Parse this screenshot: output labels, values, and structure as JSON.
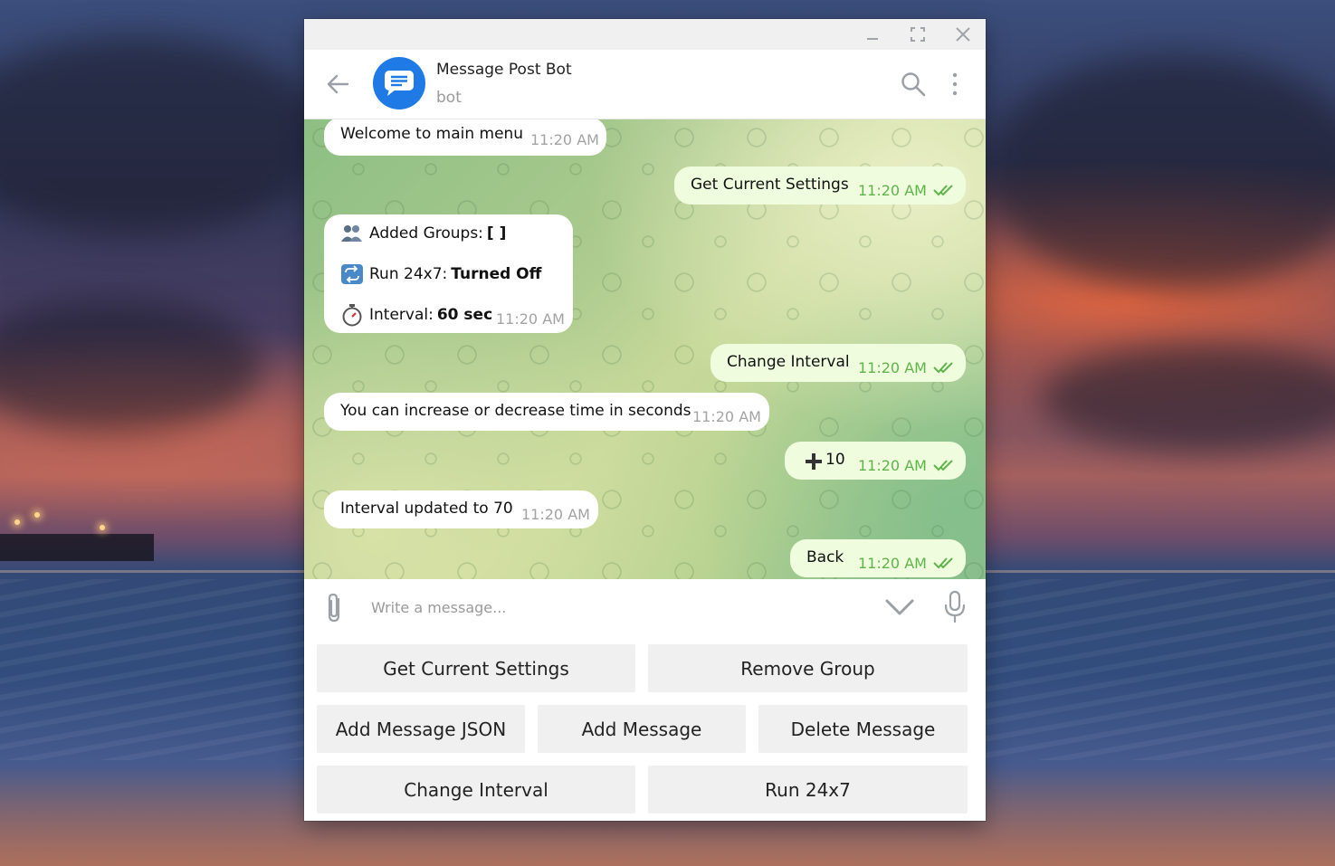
{
  "window": {
    "controls": {
      "minimize": "minimize-icon",
      "maximize": "maximize-icon",
      "close": "close-icon"
    }
  },
  "header": {
    "title": "Message Post Bot",
    "subtitle": "bot"
  },
  "messages": {
    "m1": {
      "text": "Welcome to main menu",
      "time": "11:20 AM"
    },
    "m2": {
      "text": "Get Current Settings",
      "time": "11:20 AM"
    },
    "m3": {
      "line1_label": "Added Groups: ",
      "line1_value": "[ ]",
      "line2_label": "Run 24x7: ",
      "line2_value": "Turned Off",
      "line3_label": "Interval: ",
      "line3_value": "60 sec",
      "time": "11:20 AM"
    },
    "m4": {
      "text": "Change Interval",
      "time": "11:20 AM"
    },
    "m5": {
      "text": "You can increase or decrease time in seconds",
      "time": "11:20 AM"
    },
    "m6": {
      "text": "10",
      "time": "11:20 AM"
    },
    "m7": {
      "text": "Interval updated to 70",
      "time": "11:20 AM"
    },
    "m8": {
      "text": "Back",
      "time": "11:20 AM"
    }
  },
  "composer": {
    "placeholder": "Write a message..."
  },
  "keyboard": {
    "row1": [
      "Get Current Settings",
      "Remove Group"
    ],
    "row2": [
      "Add Message JSON",
      "Add Message",
      "Delete Message"
    ],
    "row3": [
      "Change Interval",
      "Run 24x7"
    ]
  },
  "colors": {
    "accent": "#1f7ae5",
    "outgoing_bubble": "#effdde",
    "read_check": "#5fb449"
  }
}
